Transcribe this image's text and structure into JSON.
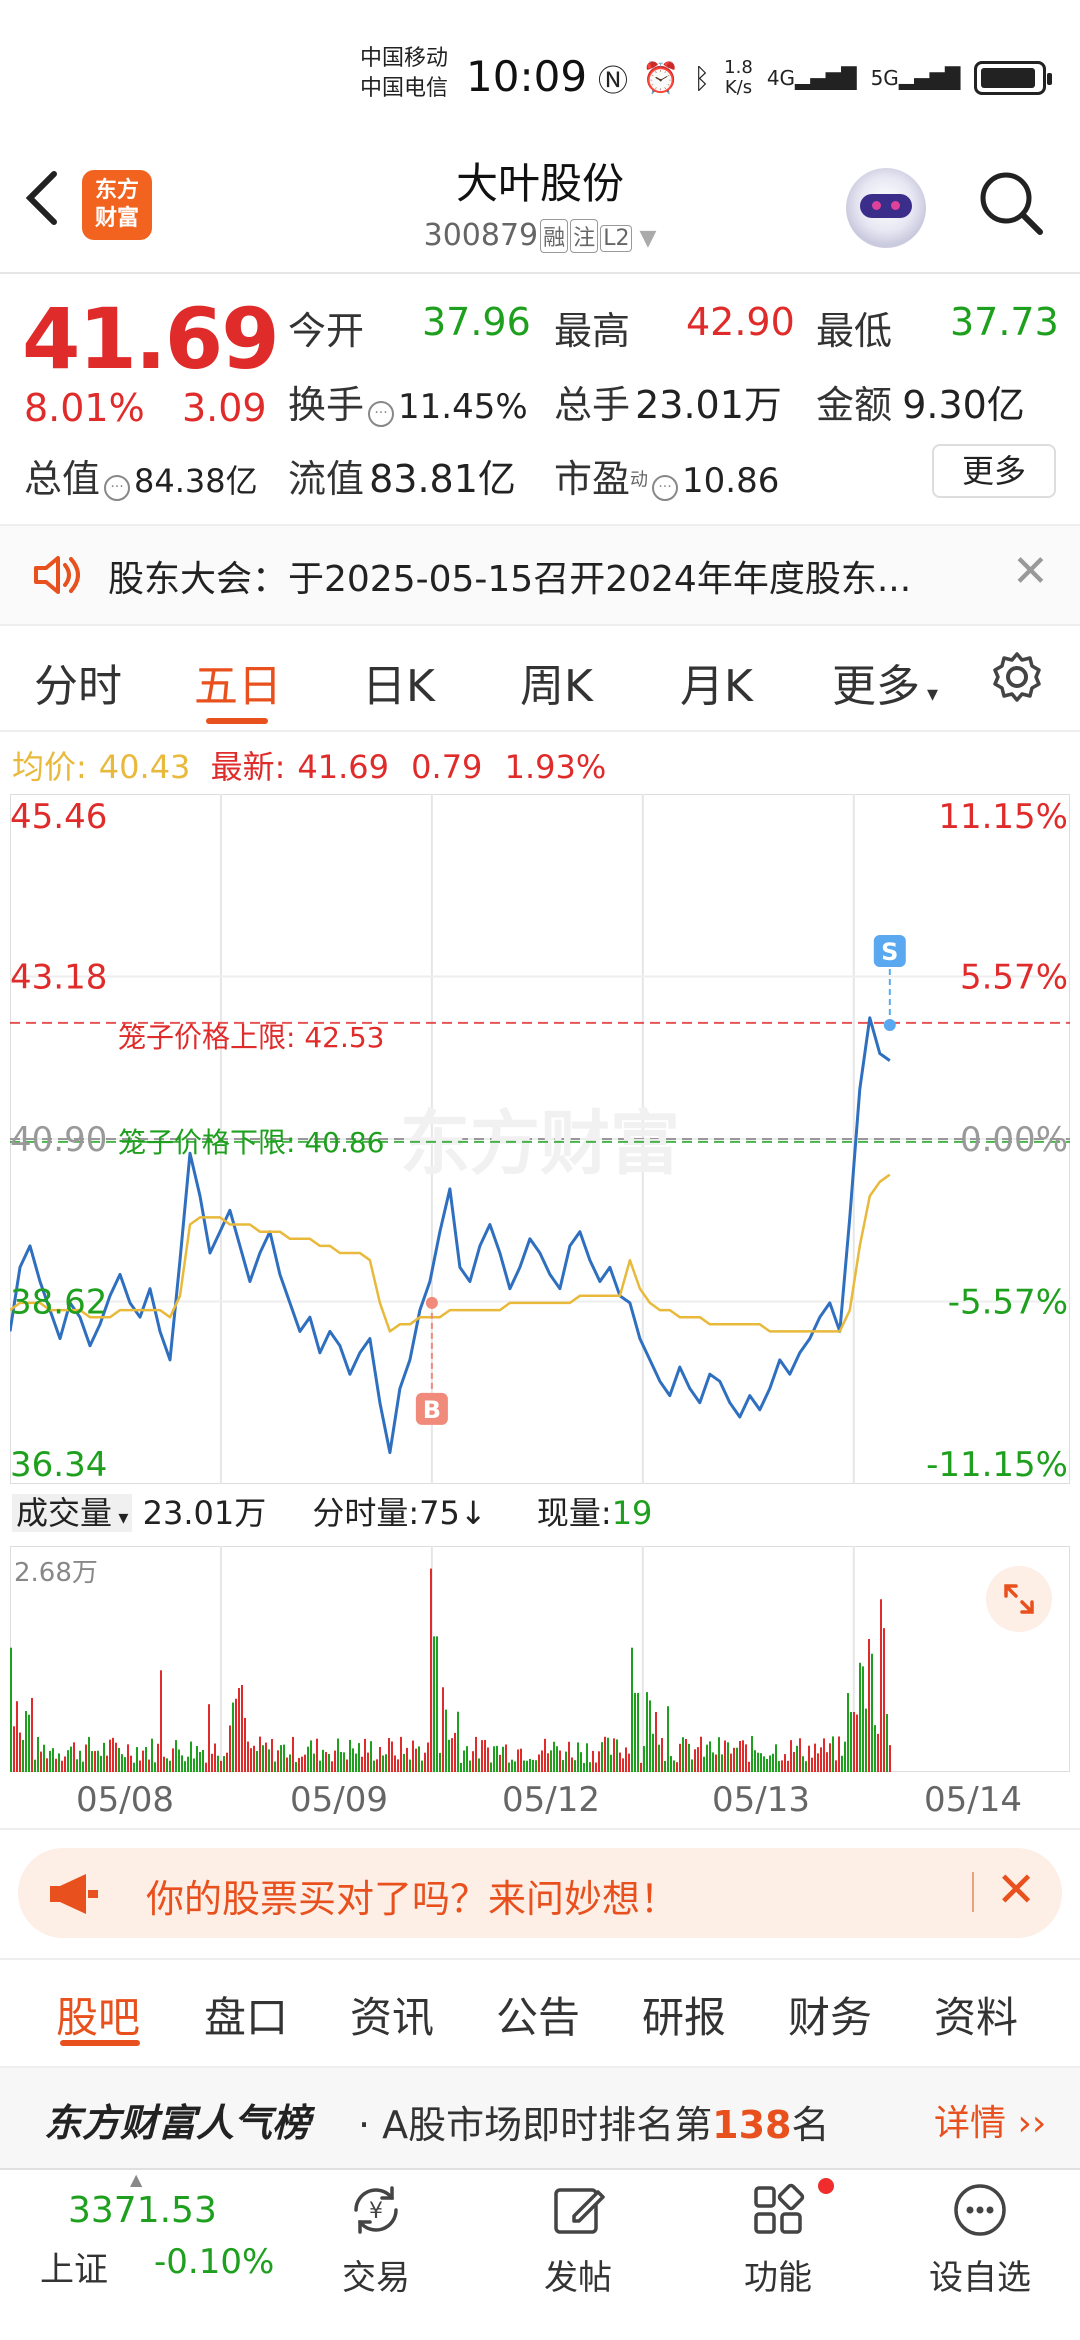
{
  "status_bar": {
    "carrier1": "中国移动",
    "carrier2": "中国电信",
    "time": "10:09",
    "speed_value": "1.8",
    "speed_unit": "K/s",
    "net1": "4G",
    "net2": "5G"
  },
  "header": {
    "back_icon": "chevron-left-icon",
    "logo_line1": "东方",
    "logo_line2": "财富",
    "title": "大叶股份",
    "code": "300879",
    "tag1": "融",
    "tag2": "注",
    "tag3": "L2",
    "assistant_icon": "robot-avatar-icon",
    "search_icon": "search-icon"
  },
  "quote": {
    "price": "41.69",
    "change_pct": "8.01%",
    "change_abs": "3.09",
    "open_label": "今开",
    "open": "37.96",
    "high_label": "最高",
    "high": "42.90",
    "low_label": "最低",
    "low": "37.73",
    "turnover_label": "换手",
    "turnover": "11.45%",
    "volume_label": "总手",
    "volume": "23.01万",
    "amount_label": "金额",
    "amount": "9.30亿",
    "mktcap_label": "总值",
    "mktcap": "84.38亿",
    "float_label": "流值",
    "float": "83.81亿",
    "pe_label": "市盈",
    "pe_sup": "动",
    "pe": "10.86",
    "more_button": "更多"
  },
  "notice": {
    "text": "股东大会：于2025-05-15召开2024年年度股东..."
  },
  "chart_tabs": [
    "分时",
    "五日",
    "日K",
    "周K",
    "月K",
    "更多"
  ],
  "legend": {
    "avg_label": "均价:",
    "avg": "40.43",
    "latest_label": "最新:",
    "latest": "41.69",
    "latest_chg": "0.79",
    "latest_pct": "1.93%"
  },
  "chart_data": {
    "type": "line",
    "ylim": [
      36.34,
      45.46
    ],
    "y_ticks": [
      "45.46",
      "43.18",
      "40.90",
      "38.62",
      "36.34"
    ],
    "y_pct_ticks": [
      "11.15%",
      "5.57%",
      "0.00%",
      "-5.57%",
      "-11.15%"
    ],
    "ref_lines": [
      {
        "label": "笼子价格上限:",
        "value": "42.53"
      },
      {
        "label": "笼子价格下限:",
        "value": "40.86"
      }
    ],
    "categories": [
      "05/08",
      "05/09",
      "05/12",
      "05/13",
      "05/14"
    ],
    "watermark": "东方财富",
    "markers": [
      {
        "label": "B",
        "day": "05/12",
        "price": 38.6
      },
      {
        "label": "S",
        "day": "05/14",
        "price": 42.5
      }
    ],
    "series": [
      {
        "name": "最新",
        "color": "#2f6fbf",
        "values": [
          38.2,
          39.1,
          39.4,
          38.9,
          38.5,
          38.1,
          38.6,
          38.4,
          38.0,
          38.3,
          38.7,
          39.0,
          38.6,
          38.4,
          38.8,
          38.2,
          37.8,
          39.2,
          40.7,
          40.1,
          39.3,
          39.6,
          39.9,
          39.4,
          38.9,
          39.3,
          39.6,
          39.0,
          38.6,
          38.2,
          38.4,
          37.9,
          38.2,
          38.0,
          37.6,
          37.9,
          38.1,
          37.2,
          36.5,
          37.4,
          37.8,
          38.5,
          38.9,
          39.6,
          40.2,
          39.1,
          38.9,
          39.4,
          39.7,
          39.3,
          38.8,
          39.1,
          39.5,
          39.3,
          39.0,
          38.8,
          39.4,
          39.6,
          39.2,
          38.9,
          39.1,
          38.7,
          38.6,
          38.1,
          37.8,
          37.5,
          37.3,
          37.7,
          37.4,
          37.2,
          37.6,
          37.5,
          37.2,
          37.0,
          37.3,
          37.1,
          37.4,
          37.8,
          37.6,
          37.9,
          38.1,
          38.4,
          38.6,
          38.2,
          39.8,
          41.6,
          42.6,
          42.1,
          42.0
        ]
      },
      {
        "name": "均价",
        "color": "#e8b93a",
        "values": [
          38.5,
          38.6,
          38.6,
          38.6,
          38.5,
          38.5,
          38.5,
          38.5,
          38.4,
          38.4,
          38.4,
          38.5,
          38.5,
          38.5,
          38.5,
          38.5,
          38.4,
          38.7,
          39.7,
          39.8,
          39.8,
          39.8,
          39.7,
          39.7,
          39.7,
          39.6,
          39.6,
          39.6,
          39.5,
          39.5,
          39.5,
          39.4,
          39.4,
          39.3,
          39.3,
          39.3,
          39.2,
          38.6,
          38.2,
          38.3,
          38.3,
          38.4,
          38.4,
          38.4,
          38.5,
          38.5,
          38.5,
          38.5,
          38.5,
          38.5,
          38.6,
          38.6,
          38.6,
          38.6,
          38.6,
          38.6,
          38.6,
          38.7,
          38.7,
          38.7,
          38.7,
          38.7,
          39.2,
          38.8,
          38.6,
          38.5,
          38.5,
          38.4,
          38.4,
          38.4,
          38.3,
          38.3,
          38.3,
          38.3,
          38.3,
          38.3,
          38.2,
          38.2,
          38.2,
          38.2,
          38.2,
          38.2,
          38.2,
          38.2,
          38.5,
          39.4,
          40.1,
          40.3,
          40.4
        ]
      }
    ]
  },
  "volume": {
    "label": "成交量",
    "total": "23.01万",
    "period_label": "分时量:75",
    "arrow": "↓",
    "now_label": "现量:",
    "now": "19",
    "max_label": "2.68万"
  },
  "ad": {
    "text": "你的股票买对了吗？来问妙想！"
  },
  "bottom_tabs": [
    "股吧",
    "盘口",
    "资讯",
    "公告",
    "研报",
    "财务",
    "资料"
  ],
  "rank": {
    "brand": "东方财富人气榜",
    "text_prefix": "· A股市场即时排名第",
    "number": "138",
    "text_suffix": "名",
    "link": "详情"
  },
  "nav": {
    "index_value": "3371.53",
    "index_name": "上证",
    "index_chg": "-0.10%",
    "items": [
      {
        "label": "交易",
        "icon": "trade-yen-icon"
      },
      {
        "label": "发帖",
        "icon": "compose-icon"
      },
      {
        "label": "功能",
        "icon": "grid-apps-icon"
      },
      {
        "label": "设自选",
        "icon": "more-dots-icon"
      }
    ]
  },
  "colors": {
    "up": "#e02b2b",
    "down": "#1ea01e",
    "accent": "#e8511d",
    "line": "#2f6fbf",
    "avg": "#e8b93a"
  }
}
